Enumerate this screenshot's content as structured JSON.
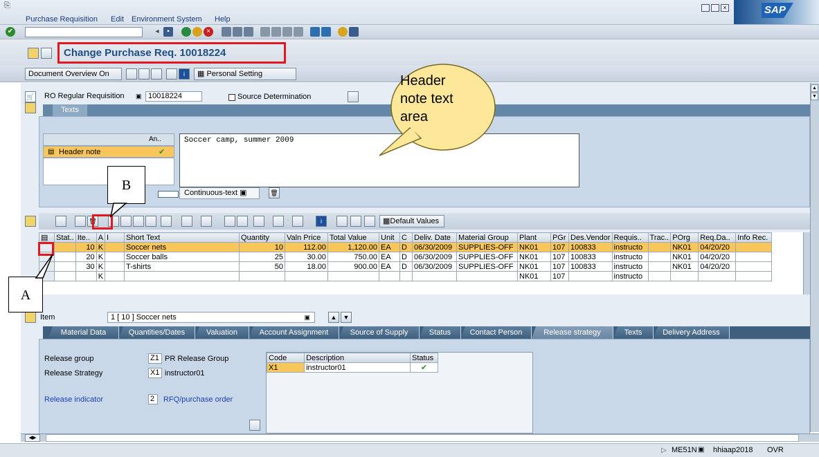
{
  "menu": [
    "Purchase Requisition",
    "Edit",
    "Environment",
    "System",
    "Help"
  ],
  "title": "Change Purchase Req. 10018224",
  "app_toolbar": {
    "document_overview": "Document Overview On",
    "personal_setting": "Personal Setting"
  },
  "header": {
    "doc_type": "RO Regular Requisition",
    "number": "10018224",
    "source_determination": "Source Determination"
  },
  "texts_tab": "Texts",
  "text_table": {
    "col": "An..",
    "row": "Header note"
  },
  "note_text": "Soccer camp, summer 2009",
  "continuous_text": "Continuous-text",
  "callout_header": "Header note text area",
  "callout_a": "A",
  "callout_b": "B",
  "default_values": "Default Values",
  "grid": {
    "columns": [
      "Stat..",
      "Ite..",
      "A",
      "I",
      "Short Text",
      "Quantity",
      "Valn Price",
      "Total Value",
      "Unit",
      "C",
      "Deliv. Date",
      "Material Group",
      "Plant",
      "PGr",
      "Des.Vendor",
      "Requis..",
      "Trac..",
      "POrg",
      "Req.Da..",
      "Info Rec."
    ],
    "rows": [
      [
        "",
        "10",
        "K",
        "",
        "Soccer nets",
        "10",
        "112.00",
        "1,120.00",
        "EA",
        "D",
        "06/30/2009",
        "SUPPLIES-OFF",
        "NK01",
        "107",
        "100833",
        "instructo",
        "",
        "NK01",
        "04/20/20",
        ""
      ],
      [
        "",
        "20",
        "K",
        "",
        "Soccer balls",
        "25",
        "30.00",
        "750.00",
        "EA",
        "D",
        "06/30/2009",
        "SUPPLIES-OFF",
        "NK01",
        "107",
        "100833",
        "instructo",
        "",
        "NK01",
        "04/20/20",
        ""
      ],
      [
        "",
        "30",
        "K",
        "",
        "T-shirts",
        "50",
        "18.00",
        "900.00",
        "EA",
        "D",
        "06/30/2009",
        "SUPPLIES-OFF",
        "NK01",
        "107",
        "100833",
        "instructo",
        "",
        "NK01",
        "04/20/20",
        ""
      ],
      [
        "",
        "",
        "K",
        "",
        "",
        "",
        "",
        "",
        "",
        "",
        "",
        "",
        "NK01",
        "107",
        "",
        "instructo",
        "",
        "",
        "",
        ""
      ]
    ]
  },
  "item": {
    "label": "Item",
    "value": "1 [ 10 ] Soccer nets"
  },
  "detail_tabs": [
    "Material Data",
    "Quantities/Dates",
    "Valuation",
    "Account Assignment",
    "Source of Supply",
    "Status",
    "Contact Person",
    "Release strategy",
    "Texts",
    "Delivery Address"
  ],
  "release": {
    "group_label": "Release group",
    "group_code": "Z1",
    "group_value": "PR Release Group",
    "strategy_label": "Release Strategy",
    "strategy_code": "X1",
    "strategy_value": "instructor01",
    "indicator_label": "Release indicator",
    "indicator_code": "2",
    "indicator_value": "RFQ/purchase order",
    "table_headers": [
      "Code",
      "Description",
      "Status"
    ],
    "table_row": [
      "X1",
      "instructor01"
    ]
  },
  "statusbar": {
    "tcode": "ME51N",
    "server": "hhiaap2018",
    "mode": "OVR"
  },
  "colors": {
    "accent_red": "#e0181f",
    "selected_row": "#f8c65a",
    "tab_blue": "#3f5f7f"
  }
}
